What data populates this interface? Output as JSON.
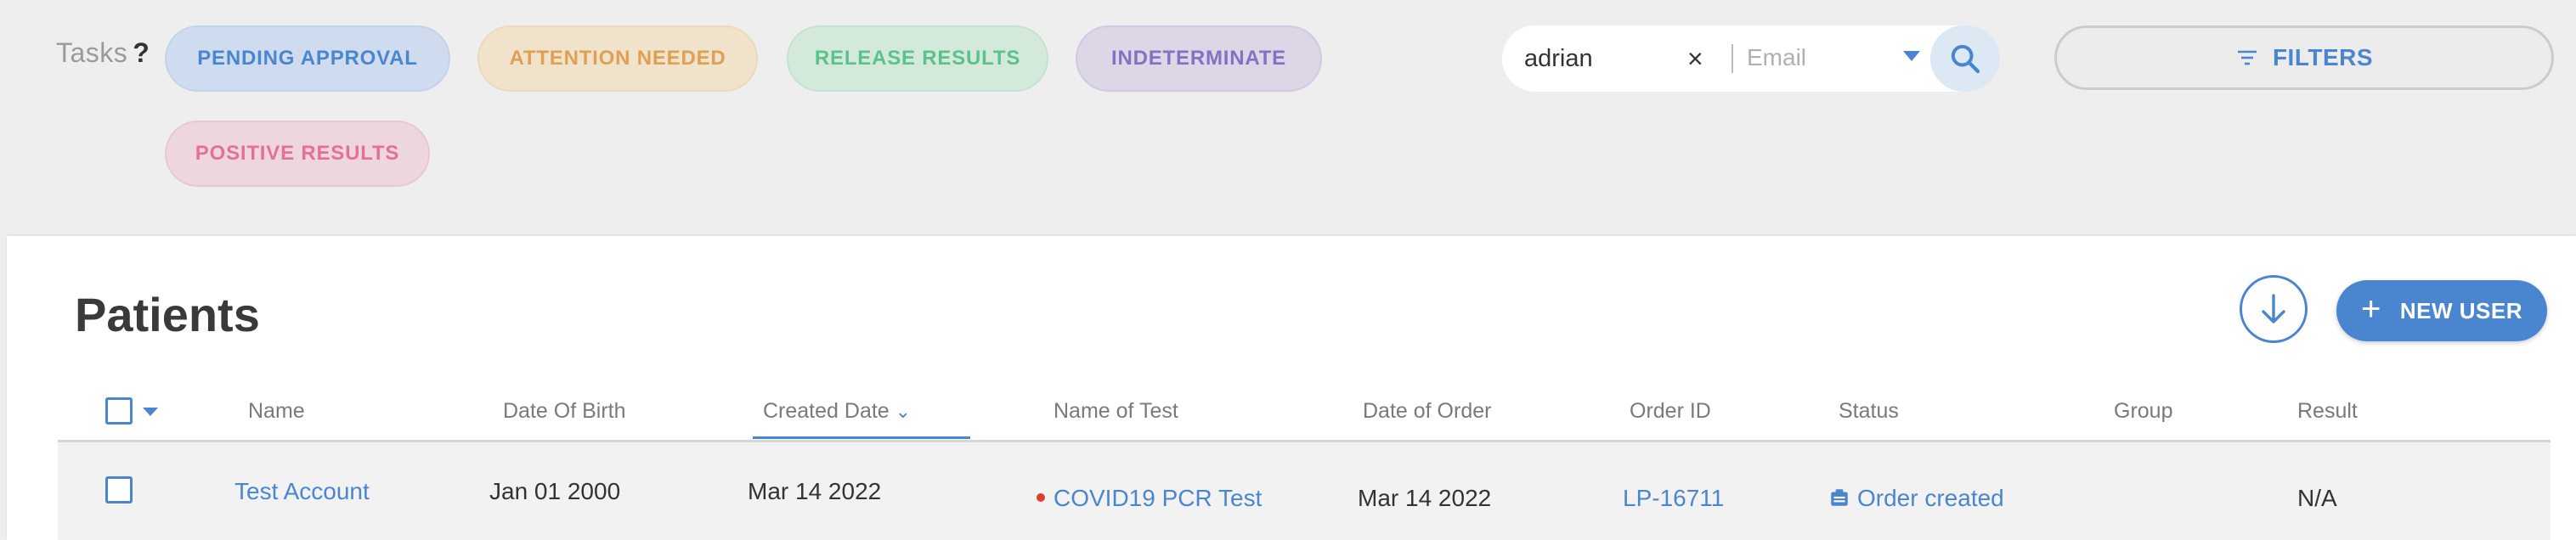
{
  "tasks": {
    "label": "Tasks",
    "help": "?",
    "chips": {
      "pending_approval": "PENDING APPROVAL",
      "attention_needed": "ATTENTION NEEDED",
      "release_results": "RELEASE RESULTS",
      "indeterminate": "INDETERMINATE",
      "positive_results": "POSITIVE RESULTS"
    }
  },
  "search": {
    "value": "adrian",
    "clear": "×",
    "field_placeholder": "Email"
  },
  "filters": {
    "label": "FILTERS"
  },
  "panel": {
    "title": "Patients",
    "new_user_label": "NEW USER",
    "new_user_plus": "+"
  },
  "table": {
    "headers": {
      "name": "Name",
      "dob": "Date Of Birth",
      "created": "Created Date",
      "test": "Name of Test",
      "order_date": "Date of Order",
      "order_id": "Order ID",
      "status": "Status",
      "group": "Group",
      "result": "Result"
    },
    "sort_indicator": "⌄",
    "rows": [
      {
        "name": "Test Account",
        "dob": "Jan 01 2000",
        "created": "Mar 14 2022",
        "test": "COVID19 PCR Test",
        "order_date": "Mar 14 2022",
        "order_id": "LP-16711",
        "status": "Order created",
        "group": "",
        "result": "N/A"
      }
    ]
  },
  "colors": {
    "accent": "#4a86d0",
    "status_dot": "#e0402b"
  }
}
